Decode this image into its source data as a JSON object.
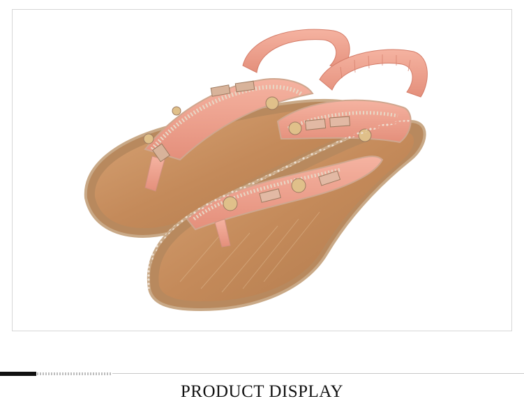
{
  "section": {
    "caption": "PRODUCT DISPLAY"
  },
  "photo": {
    "subject_icon": "sandal-pair-image",
    "colors": {
      "strap": "#f0a391",
      "footbed": "#c89060",
      "sole": "#b88b60",
      "rhinestone": "#e6d2c0",
      "divider_dark": "#111111"
    }
  }
}
